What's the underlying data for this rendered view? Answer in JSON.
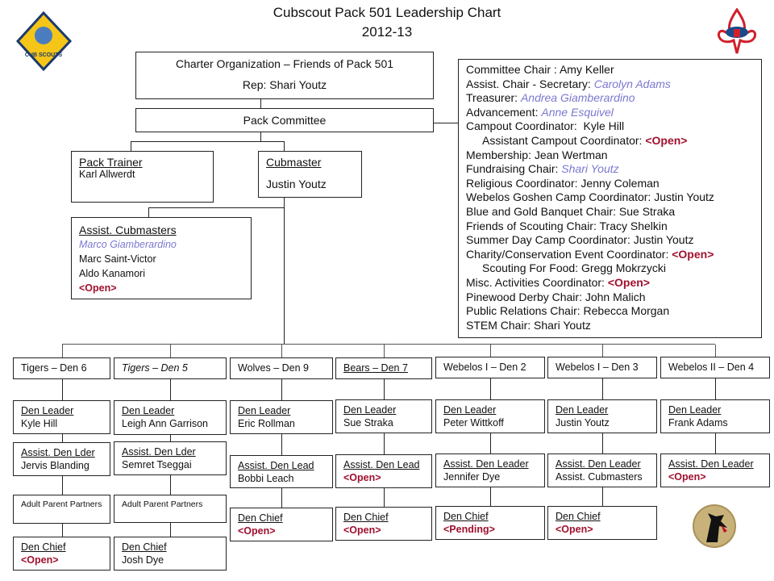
{
  "header": {
    "title": "Cubscout Pack 501 Leadership Chart",
    "subtitle": "2012-13"
  },
  "logos": {
    "cub_scout": "Cub Scouts logo",
    "bsa": "BSA logo",
    "pack_committee": "Pack Committee",
    "webelos": "Webelos logo"
  },
  "charter": {
    "line1": "Charter Organization – Friends of Pack 501",
    "line2": "Rep: Shari Youtz"
  },
  "pack_committee": {
    "label": "Pack Committee"
  },
  "pack_trainer": {
    "title": "Pack Trainer",
    "name": "Karl Allwerdt"
  },
  "cubmaster": {
    "title": "Cubmaster",
    "name": "Justin Youtz"
  },
  "assist_cubmasters": {
    "title": "Assist. Cubmasters",
    "names": [
      {
        "text": "Marco Giamberardino",
        "style": "blue"
      },
      {
        "text": "Marc Saint-Victor",
        "style": ""
      },
      {
        "text": "Aldo Kanamori",
        "style": ""
      },
      {
        "text": "<Open>",
        "style": "open"
      }
    ]
  },
  "committee": [
    {
      "label": "Committee Chair : ",
      "value": "Amy Keller",
      "style": "",
      "indent": false
    },
    {
      "label": "Assist. Chair - Secretary: ",
      "value": "Carolyn Adams",
      "style": "blue",
      "indent": false
    },
    {
      "label": "Treasurer: ",
      "value": "Andrea Giamberardino",
      "style": "blue",
      "indent": false
    },
    {
      "label": "Advancement: ",
      "value": "Anne Esquivel",
      "style": "blue",
      "indent": false
    },
    {
      "label": "Campout Coordinator:  ",
      "value": "Kyle Hill",
      "style": "",
      "indent": false
    },
    {
      "label": "Assistant Campout Coordinator: ",
      "value": "<Open>",
      "style": "open",
      "indent": true
    },
    {
      "label": "Membership: ",
      "value": "Jean Wertman",
      "style": "",
      "indent": false
    },
    {
      "label": "Fundraising Chair: ",
      "value": "Shari Youtz",
      "style": "blue",
      "indent": false
    },
    {
      "label": "Religious Coordinator: ",
      "value": "Jenny Coleman",
      "style": "",
      "indent": false
    },
    {
      "label": "Webelos Goshen Camp Coordinator: ",
      "value": "Justin Youtz",
      "style": "",
      "indent": false
    },
    {
      "label": "Blue and Gold Banquet Chair: ",
      "value": "Sue Straka",
      "style": "",
      "indent": false
    },
    {
      "label": "Friends of Scouting Chair: ",
      "value": "Tracy Shelkin",
      "style": "",
      "indent": false
    },
    {
      "label": "Summer Day Camp Coordinator: ",
      "value": "Justin Youtz",
      "style": "",
      "indent": false
    },
    {
      "label": "Charity/Conservation Event Coordinator: ",
      "value": "<Open>",
      "style": "open",
      "indent": false
    },
    {
      "label": "Scouting For Food: ",
      "value": "Gregg Mokrzycki",
      "style": "",
      "indent": true
    },
    {
      "label": "Misc. Activities Coordinator: ",
      "value": "<Open>",
      "style": "open",
      "indent": false
    },
    {
      "label": "Pinewood Derby Chair: ",
      "value": "John Malich",
      "style": "",
      "indent": false
    },
    {
      "label": "Public Relations Chair: ",
      "value": "Rebecca Morgan",
      "style": "",
      "indent": false
    },
    {
      "label": "STEM Chair: ",
      "value": "Shari Youtz",
      "style": "",
      "indent": false
    }
  ],
  "dens": [
    {
      "name": "Tigers – Den 6",
      "name_style": "",
      "roles": [
        {
          "title": "Den Leader",
          "value": "Kyle Hill",
          "style": ""
        },
        {
          "title": "Assist. Den Lder",
          "value": "Jervis Blanding",
          "style": ""
        },
        {
          "title": "Adult Parent Partners",
          "value": "",
          "style": "small"
        },
        {
          "title": "Den Chief",
          "value": "<Open>",
          "style": "open"
        }
      ]
    },
    {
      "name": "Tigers – Den 5",
      "name_style": "italic",
      "roles": [
        {
          "title": "Den Leader",
          "value": "Leigh Ann Garrison",
          "style": ""
        },
        {
          "title": "Assist. Den Lder",
          "value": "Semret Tseggai",
          "style": ""
        },
        {
          "title": "Adult Parent Partners",
          "value": "",
          "style": "small"
        },
        {
          "title": "Den Chief",
          "value": "Josh Dye",
          "style": ""
        }
      ]
    },
    {
      "name": "Wolves – Den 9",
      "name_style": "",
      "roles": [
        {
          "title": "Den Leader",
          "value": "Eric  Rollman",
          "style": ""
        },
        {
          "title": "Assist. Den Lead",
          "value": "Bobbi Leach",
          "style": ""
        },
        {
          "title": "Den Chief",
          "value": "<Open>",
          "style": "open"
        }
      ]
    },
    {
      "name": "Bears – Den 7",
      "name_style": "underline",
      "roles": [
        {
          "title": "Den Leader",
          "value": "Sue Straka",
          "style": ""
        },
        {
          "title": "Assist. Den Lead",
          "value": "<Open>",
          "style": "open"
        },
        {
          "title": "Den Chief",
          "value": "<Open>",
          "style": "open"
        }
      ]
    },
    {
      "name": "Webelos I – Den 2",
      "name_style": "",
      "roles": [
        {
          "title": "Den Leader",
          "value": "Peter Wittkoff",
          "style": ""
        },
        {
          "title": "Assist. Den Leader",
          "value": "Jennifer Dye",
          "style": ""
        },
        {
          "title": "Den Chief",
          "value": "<Pending>",
          "style": "open"
        }
      ]
    },
    {
      "name": "Webelos I – Den 3",
      "name_style": "",
      "roles": [
        {
          "title": "Den Leader",
          "value": "Justin Youtz",
          "style": ""
        },
        {
          "title": "Assist. Den Leader",
          "value": "Assist. Cubmasters",
          "style": ""
        },
        {
          "title": "Den Chief",
          "value": "<Open>",
          "style": "open"
        }
      ]
    },
    {
      "name": "Webelos II – Den 4",
      "name_style": "",
      "roles": [
        {
          "title": "Den Leader",
          "value": "Frank  Adams",
          "style": ""
        },
        {
          "title": "Assist. Den Leader",
          "value": "<Open>",
          "style": "open"
        }
      ]
    }
  ]
}
